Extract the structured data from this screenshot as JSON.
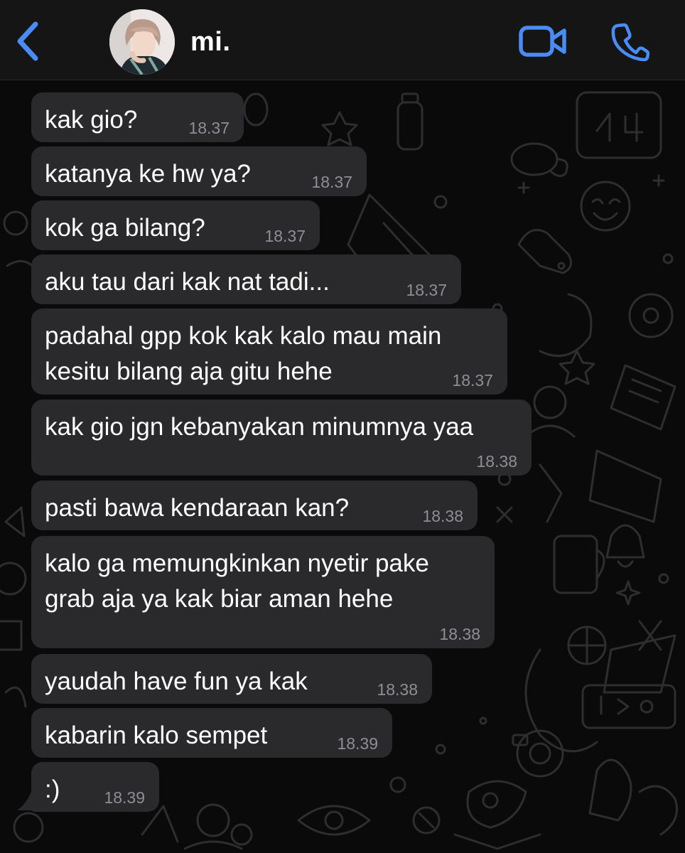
{
  "header": {
    "contact_name": "mi.",
    "back_icon": "chevron-left-icon",
    "video_icon": "video-camera-icon",
    "call_icon": "phone-icon",
    "accent_color": "#4a8cf5"
  },
  "messages": [
    {
      "text": "kak gio?",
      "time": "18.37"
    },
    {
      "text": "katanya ke hw ya?",
      "time": "18.37"
    },
    {
      "text": "kok ga bilang?",
      "time": "18.37"
    },
    {
      "text": "aku tau dari kak nat tadi...",
      "time": "18.37"
    },
    {
      "text": "padahal gpp kok kak kalo mau main\nkesitu bilang aja gitu hehe",
      "time": "18.37"
    },
    {
      "text": "kak gio jgn kebanyakan minumnya yaa",
      "time": "18.38"
    },
    {
      "text": "pasti bawa kendaraan kan?",
      "time": "18.38"
    },
    {
      "text": "kalo ga memungkinkan nyetir pake\ngrab aja ya kak biar aman hehe",
      "time": "18.38"
    },
    {
      "text": "yaudah have fun ya kak",
      "time": "18.38"
    },
    {
      "text": "kabarin kalo sempet",
      "time": "18.39"
    },
    {
      "text": ":)",
      "time": "18.39"
    }
  ],
  "colors": {
    "bubble_incoming": "#2a2a2c",
    "header_bg": "#151515",
    "timestamp": "#8e8e93"
  }
}
